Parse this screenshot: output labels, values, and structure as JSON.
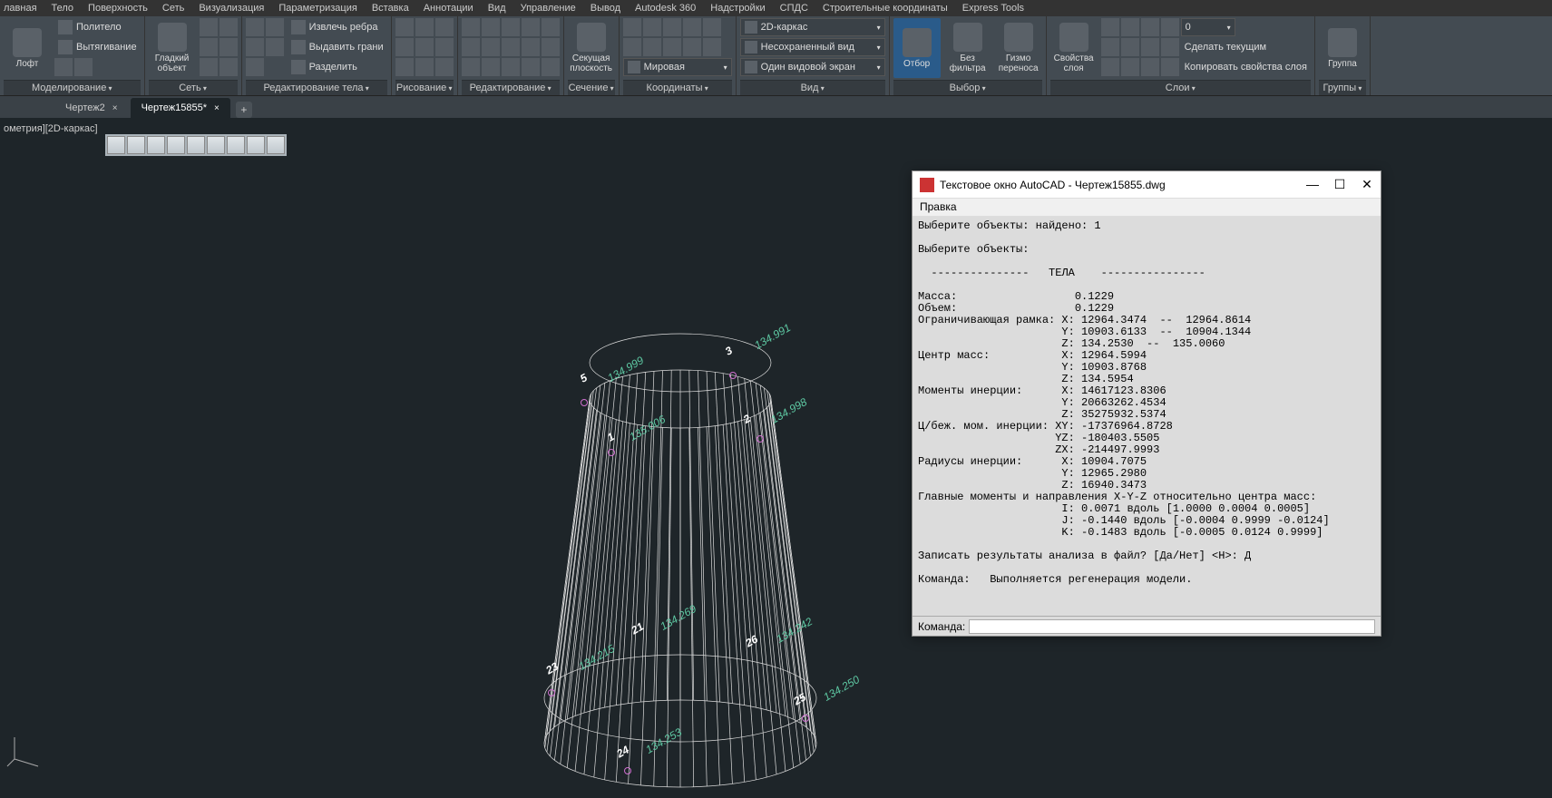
{
  "menus": [
    "лавная",
    "Тело",
    "Поверхность",
    "Сеть",
    "Визуализация",
    "Параметризация",
    "Вставка",
    "Аннотации",
    "Вид",
    "Управление",
    "Вывод",
    "Autodesk 360",
    "Надстройки",
    "СПДС",
    "Строительные координаты",
    "Express Tools"
  ],
  "ribbon": {
    "modeling": {
      "label": "Моделирование",
      "loft": "Лофт",
      "polysolid": "Политело",
      "presspull": "Вытягивание"
    },
    "mesh": {
      "label": "Сеть",
      "smooth": "Гладкий объект"
    },
    "editbody": {
      "label": "Редактирование тела",
      "extract": "Извлечь ребра",
      "faces": "Выдавить грани",
      "split": "Разделить"
    },
    "draw": {
      "label": "Рисование"
    },
    "modify": {
      "label": "Редактирование"
    },
    "section": {
      "label": "Сечение",
      "plane": "Секущая плоскость"
    },
    "coords": {
      "label": "Координаты",
      "wcs": "Мировая"
    },
    "view": {
      "label": "Вид",
      "style": "2D-каркас",
      "unsaved": "Несохраненный вид",
      "single": "Один видовой экран"
    },
    "select": {
      "label": "Выбор",
      "filter_btn": "Отбор",
      "nofilter": "Без фильтра",
      "gizmo": "Гизмо переноса"
    },
    "layers": {
      "label": "Слои",
      "props": "Свойства слоя",
      "current": "Сделать текущим",
      "copy": "Копировать свойства слоя",
      "layer0": "0"
    },
    "groups": {
      "label": "Группы",
      "group": "Группа"
    }
  },
  "tabs": {
    "t1": "Чертеж2",
    "t2": "Чертеж15855*"
  },
  "viewport_label": "ометрия][2D-каркас]",
  "elevations": {
    "e1": "134.999",
    "e2": "134.998",
    "e3": "134.991",
    "e4": "135.006",
    "b1": "134.215",
    "b2": "134.269",
    "b3": "134.242",
    "b4": "134.250",
    "b5": "134.253"
  },
  "points": {
    "p1": "1",
    "p2": "2",
    "p3": "3",
    "p5": "5",
    "p21": "21",
    "p23": "23",
    "p24": "24",
    "p25": "25",
    "p26": "26"
  },
  "textwin": {
    "title": "Текстовое окно AutoCAD - Чертеж15855.dwg",
    "menu": "Правка",
    "body": "Выберите объекты: найдено: 1\n\nВыберите объекты:\n\n  ---------------   ТЕЛА    ----------------\n\nМасса:                  0.1229\nОбъем:                  0.1229\nОграничивающая рамка: X: 12964.3474  --  12964.8614\n                      Y: 10903.6133  --  10904.1344\n                      Z: 134.2530  --  135.0060\nЦентр масс:           X: 12964.5994\n                      Y: 10903.8768\n                      Z: 134.5954\nМоменты инерции:      X: 14617123.8306\n                      Y: 20663262.4534\n                      Z: 35275932.5374\nЦ/беж. мом. инерции: XY: -17376964.8728\n                     YZ: -180403.5505\n                     ZX: -214497.9993\nРадиусы инерции:      X: 10904.7075\n                      Y: 12965.2980\n                      Z: 16940.3473\nГлавные моменты и направления X-Y-Z относительно центра масс:\n                      I: 0.0071 вдоль [1.0000 0.0004 0.0005]\n                      J: -0.1440 вдоль [-0.0004 0.9999 -0.0124]\n                      K: -0.1483 вдоль [-0.0005 0.0124 0.9999]\n\nЗаписать результаты анализа в файл? [Да/Нет] <Н>: Д\n\nКоманда:   Выполняется регенерация модели.\n",
    "prompt": "Команда:"
  }
}
